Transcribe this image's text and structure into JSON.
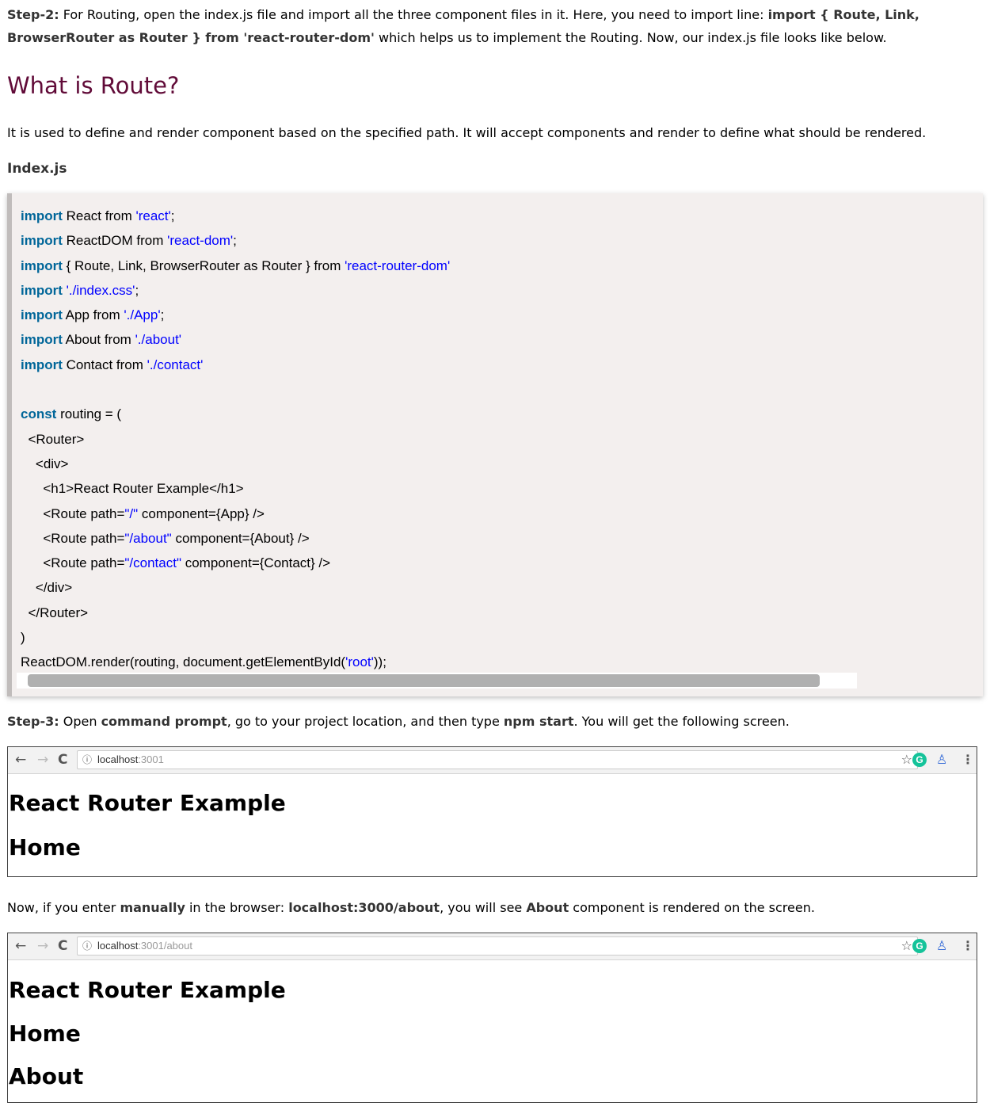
{
  "step2": {
    "label": "Step-2:",
    "text1": " For Routing, open the index.js file and import all the three component files in it. Here, you need to import line: ",
    "bold1": "import { Route, Link,",
    "bold2": "BrowserRouter as Router } from 'react-router-dom'",
    "text2": " which helps us to implement the Routing. Now, our index.js file looks like below."
  },
  "route_section": {
    "heading": "What is Route?",
    "description": "It is used to define and render component based on the specified path. It will accept components and render to define what should be rendered.",
    "file_label": "Index.js"
  },
  "code": {
    "l1": {
      "kw": "import",
      "t": " React from ",
      "s": "'react'",
      "e": ";"
    },
    "l2": {
      "kw": "import",
      "t": " ReactDOM from ",
      "s": "'react-dom'",
      "e": ";"
    },
    "l3": {
      "kw": "import",
      "t": " { Route, Link, BrowserRouter as Router } from ",
      "s": "'react-router-dom'",
      "e": ""
    },
    "l4": {
      "kw": "import",
      "t": " ",
      "s": "'./index.css'",
      "e": ";"
    },
    "l5": {
      "kw": "import",
      "t": " App from ",
      "s": "'./App'",
      "e": ";"
    },
    "l6": {
      "kw": "import",
      "t": " About from ",
      "s": "'./about'",
      "e": ""
    },
    "l7": {
      "kw": "import",
      "t": " Contact from ",
      "s": "'./contact'",
      "e": ""
    },
    "l9": {
      "kw": "const",
      "t": " routing = ("
    },
    "l10": "  <Router>",
    "l11": "    <div>",
    "l12": "      <h1>React Router Example</h1>",
    "l13": {
      "a": "      <Route path=",
      "s": "\"/\"",
      "b": " component={App} />"
    },
    "l14": {
      "a": "      <Route path=",
      "s": "\"/about\"",
      "b": " component={About} />"
    },
    "l15": {
      "a": "      <Route path=",
      "s": "\"/contact\"",
      "b": " component={Contact} />"
    },
    "l16": "    </div>",
    "l17": "  </Router>",
    "l18": ")",
    "l19": {
      "a": "ReactDOM.render(routing, document.getElementById(",
      "s": "'root'",
      "b": "));"
    }
  },
  "step3": {
    "label": "Step-3:",
    "t1": " Open ",
    "b1": "command prompt",
    "t2": ", go to your project location, and then type ",
    "b2": "npm start",
    "t3": ". You will get the following screen."
  },
  "browser1": {
    "url_host": "localhost",
    "url_rest": ":3001",
    "h1": "React Router Example",
    "h2": "Home"
  },
  "manual": {
    "t1": "Now, if you enter ",
    "b1": "manually",
    "t2": " in the browser: ",
    "b2": "localhost:3000/about",
    "t3": ", you will see ",
    "b3": "About",
    "t4": " component is rendered on the screen."
  },
  "browser2": {
    "url_host": "localhost",
    "url_rest": ":3001/about",
    "h1": "React Router Example",
    "h2": "Home",
    "h3": "About"
  },
  "icons": {
    "back": "←",
    "forward": "→",
    "reload": "C",
    "info": "ⓘ",
    "star": "☆",
    "grammarly": "G",
    "profile": "♙",
    "menu": "⋮"
  }
}
